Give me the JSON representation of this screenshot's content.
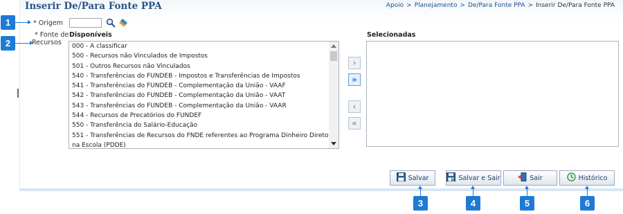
{
  "header": {
    "title": "Inserir De/Para Fonte PPA",
    "breadcrumb": [
      "Apoio",
      "Planejamento",
      "De/Para Fonte PPA",
      "Inserir De/Para Fonte PPA"
    ],
    "breadcrumb_separator": ">"
  },
  "form": {
    "origem_label": "* Origem",
    "origem_value": "",
    "fonte_label_line1": "* Fonte de",
    "fonte_label_line2": "Recursos"
  },
  "lists": {
    "available_title": "Disponíveis",
    "selected_title": "Selecionadas",
    "available_items": [
      "000 - A classificar",
      "500 - Recursos não Vinculados de Impostos",
      "501 - Outros Recursos não Vinculados",
      "540 - Transferências do FUNDEB - Impostos e Transferências de Impostos",
      "541 - Transferências do FUNDEB - Complementação da União - VAAF",
      "542 - Transferências do FUNDEB - Complementação da União - VAAT",
      "543 - Transferências do FUNDEB - Complementação da União - VAAR",
      "544 - Recursos de Precatórios do FUNDEF",
      "550 - Transferência do Salário-Educação",
      "551 - Transferências de Recursos do FNDE referentes ao Programa Dinheiro Direto na Escola (PDDE)"
    ],
    "selected_items": []
  },
  "move_buttons": {
    "add_one": "›",
    "add_all": "»",
    "remove_one": "‹",
    "remove_all": "«"
  },
  "actions": {
    "save": "Salvar",
    "save_exit": "Salvar e Sair",
    "exit": "Sair",
    "history": "Histórico"
  },
  "markers": [
    "1",
    "2",
    "3",
    "4",
    "5",
    "6"
  ],
  "colors": {
    "accent": "#1f7ad6",
    "title": "#2a5487",
    "link": "#1f4f89"
  },
  "icons": {
    "search": "search-icon",
    "clear": "eraser-icon",
    "save": "floppy-disk-icon",
    "save_exit": "floppy-disk-exit-icon",
    "exit": "door-exit-icon",
    "history": "history-clock-icon"
  }
}
